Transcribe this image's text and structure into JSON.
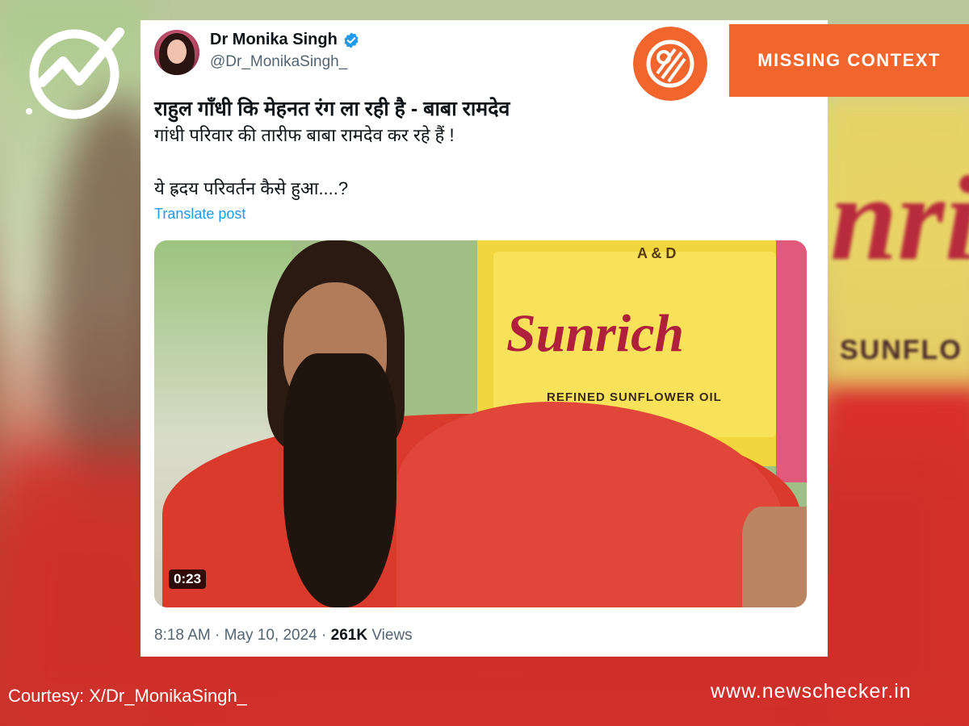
{
  "tweet": {
    "author_name": "Dr Monika Singh",
    "author_handle": "@Dr_MonikaSingh_",
    "line1": "राहुल गाँधी कि मेहनत रंग ला रही है - बाबा रामदेव",
    "line2": "गांधी परिवार की तारीफ बाबा रामदेव कर रहे हैं !",
    "line3": "ये ह्रदय परिवर्तन कैसे हुआ....?",
    "translate_label": "Translate post",
    "video_duration": "0:23",
    "video_brand": "Sunrich",
    "video_brand_sub": "REFINED SUNFLOWER OIL",
    "video_pack_text": "A & D",
    "time": "8:18 AM",
    "separator": " · ",
    "date": "May 10, 2024",
    "views_count": "261K",
    "views_label": " Views"
  },
  "background": {
    "brand_word": "nri",
    "brand_sub": "SUNFLO"
  },
  "badge_label": "MISSING CONTEXT",
  "courtesy": "Courtesy: X/Dr_MonikaSingh_",
  "site": "www.newschecker.in",
  "colors": {
    "accent_orange": "#f2662e",
    "link_blue": "#1d9bf0",
    "verified_blue": "#1d9bf0"
  },
  "icons": {
    "logo": "newschecker-logo-icon",
    "verified": "verified-badge-icon",
    "stamp": "fact-check-stamp-icon"
  }
}
